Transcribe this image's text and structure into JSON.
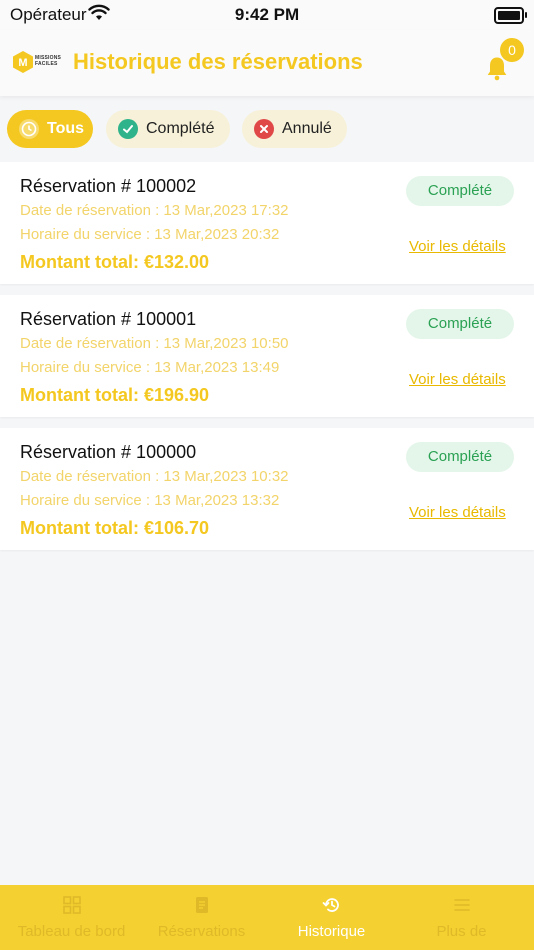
{
  "status_bar": {
    "carrier": "Opérateur",
    "time": "9:42 PM"
  },
  "header": {
    "logo_text_1": "MISSIONS",
    "logo_text_2": "FACILES",
    "logo_letter": "M",
    "title": "Historique des réservations",
    "notification_count": "0"
  },
  "filters": [
    {
      "label": "Tous",
      "active": true
    },
    {
      "label": "Complété",
      "active": false
    },
    {
      "label": "Annulé",
      "active": false
    }
  ],
  "reservations": [
    {
      "title": "Réservation # 100002",
      "date_line": "Date de réservation : 13 Mar,2023 17:32",
      "service_line": "Horaire du service : 13 Mar,2023 20:32",
      "total": "Montant total: €132.00",
      "status": "Complété",
      "details": "Voir les détails"
    },
    {
      "title": "Réservation # 100001",
      "date_line": "Date de réservation : 13 Mar,2023 10:50",
      "service_line": "Horaire du service : 13 Mar,2023 13:49",
      "total": "Montant total: €196.90",
      "status": "Complété",
      "details": "Voir les détails"
    },
    {
      "title": "Réservation # 100000",
      "date_line": "Date de réservation : 13 Mar,2023 10:32",
      "service_line": "Horaire du service : 13 Mar,2023 13:32",
      "total": "Montant total: €106.70",
      "status": "Complété",
      "details": "Voir les détails"
    }
  ],
  "tabbar": [
    {
      "label": "Tableau de bord",
      "icon": "grid-icon"
    },
    {
      "label": "Réservations",
      "icon": "document-icon"
    },
    {
      "label": "Historique",
      "icon": "history-icon",
      "active": true
    },
    {
      "label": "Plus de",
      "icon": "menu-icon"
    }
  ],
  "colors": {
    "accent": "#f4c820",
    "success": "#2aa153",
    "danger": "#e04848"
  }
}
